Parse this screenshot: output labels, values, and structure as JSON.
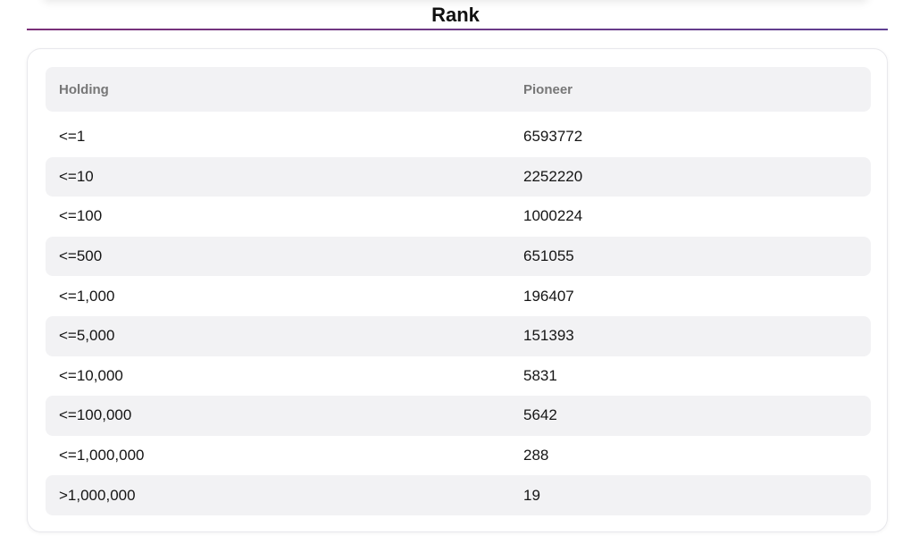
{
  "title": "Rank",
  "table": {
    "headers": [
      "Holding",
      "Pioneer"
    ],
    "rows": [
      [
        "<=1",
        "6593772"
      ],
      [
        "<=10",
        "2252220"
      ],
      [
        "<=100",
        "1000224"
      ],
      [
        "<=500",
        "651055"
      ],
      [
        "<=1,000",
        "196407"
      ],
      [
        "<=5,000",
        "151393"
      ],
      [
        "<=10,000",
        "5831"
      ],
      [
        "<=100,000",
        "5642"
      ],
      [
        "<=1,000,000",
        "288"
      ],
      [
        ">1,000,000",
        "19"
      ]
    ]
  },
  "colors": {
    "accent_line": "#6d3a86",
    "row_alt_bg": "#f2f2f4",
    "header_text": "#777777"
  }
}
